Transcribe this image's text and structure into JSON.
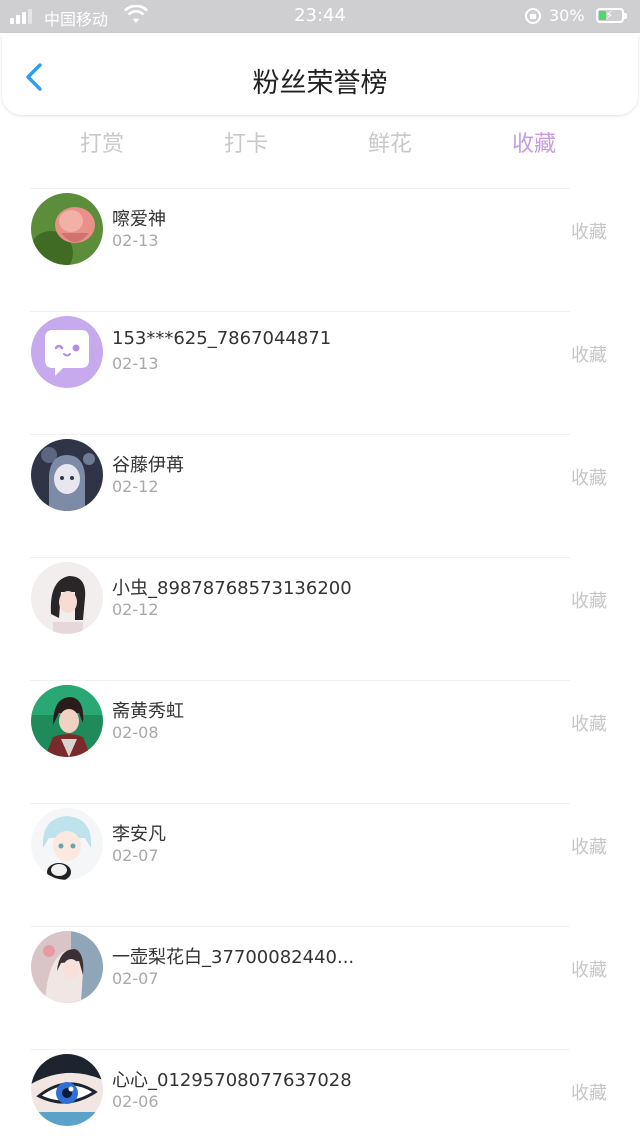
{
  "status_bar": {
    "carrier": "中国移动",
    "time": "23:44",
    "battery": "30%",
    "battery_level": 0.3
  },
  "nav": {
    "title": "粉丝荣誉榜",
    "back_icon": "chevron-left-icon"
  },
  "tabs": [
    {
      "label": "打赏",
      "active": false
    },
    {
      "label": "打卡",
      "active": false
    },
    {
      "label": "鲜花",
      "active": false
    },
    {
      "label": "收藏",
      "active": true
    }
  ],
  "list": {
    "items": [
      {
        "name": "嚓爱神",
        "date": "02-13",
        "action": "收藏"
      },
      {
        "name": "153***625_7867044871",
        "date": "02-13",
        "action": "收藏"
      },
      {
        "name": "谷藤伊苒",
        "date": "02-12",
        "action": "收藏"
      },
      {
        "name": "小虫_89878768573136200",
        "date": "02-12",
        "action": "收藏"
      },
      {
        "name": "斋黄秀虹",
        "date": "02-08",
        "action": "收藏"
      },
      {
        "name": "李安凡",
        "date": "02-07",
        "action": "收藏"
      },
      {
        "name": "一壶梨花白_37700082440...",
        "date": "02-07",
        "action": "收藏"
      },
      {
        "name": "心心_01295708077637028",
        "date": "02-06",
        "action": "收藏"
      }
    ]
  },
  "colors": {
    "accent": "#c59de0",
    "back_arrow": "#2a9df4",
    "inactive_tab": "#c9c9c9"
  }
}
